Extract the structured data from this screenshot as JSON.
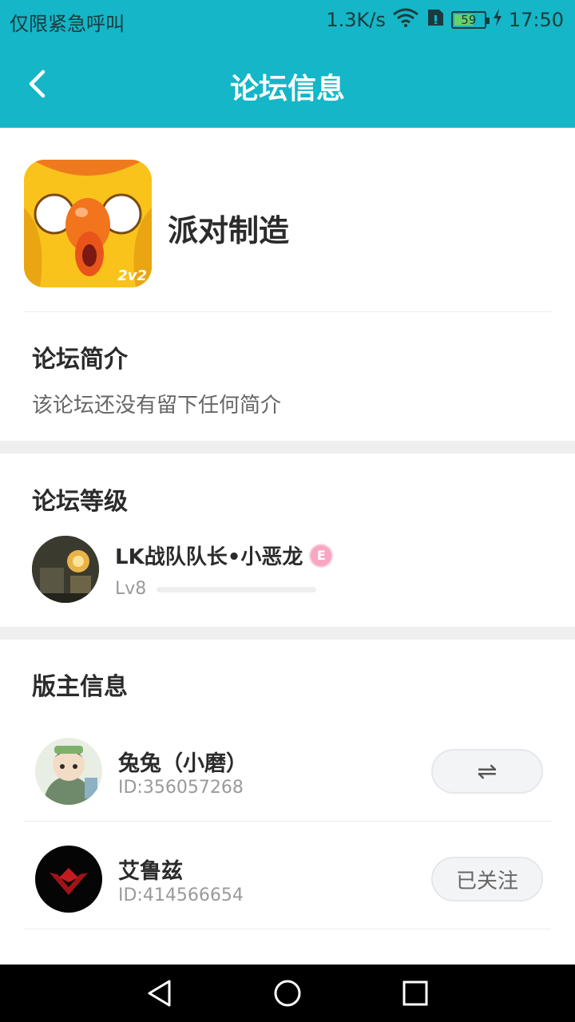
{
  "status_bar": {
    "carrier": "仅限紧急呼叫",
    "speed": "1.3K/s",
    "battery": "59",
    "battery_level": 0.59,
    "time": "17:50",
    "icons": [
      "wifi-icon",
      "sim-icon",
      "battery-icon",
      "charging-icon"
    ]
  },
  "nav": {
    "back_icon": "chevron-left-icon",
    "title": "论坛信息"
  },
  "forum": {
    "name": "派对制造",
    "logo_badge": "2v2"
  },
  "intro": {
    "title": "论坛简介",
    "text": "该论坛还没有留下任何简介"
  },
  "level": {
    "title": "论坛等级",
    "user_name": "LK战队队长•小恶龙",
    "badge_text": "E",
    "level_label": "Lv8",
    "progress": 0
  },
  "moderators": {
    "title": "版主信息",
    "items": [
      {
        "name": "兔兔（小磨）",
        "id": "ID:356057268",
        "action": "⇌",
        "action_icon": "swap-icon"
      },
      {
        "name": "艾鲁兹",
        "id": "ID:414566654",
        "action": "已关注"
      }
    ]
  },
  "colors": {
    "header": "#14b6c7",
    "text_primary": "#2b2b2b",
    "text_secondary": "#9a9a9a"
  },
  "system_nav": [
    "back-triangle-icon",
    "home-circle-icon",
    "recents-square-icon"
  ]
}
